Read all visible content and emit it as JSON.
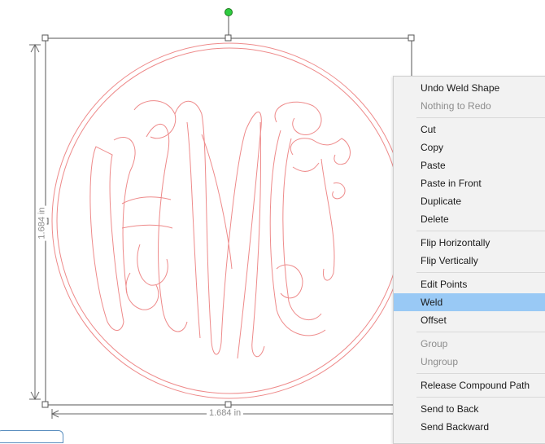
{
  "selection": {
    "width_label": "1.684 in",
    "height_label": "1.684 in"
  },
  "context_menu": {
    "groups": [
      [
        {
          "label": "Undo Weld Shape",
          "enabled": true
        },
        {
          "label": "Nothing to Redo",
          "enabled": false
        }
      ],
      [
        {
          "label": "Cut",
          "enabled": true
        },
        {
          "label": "Copy",
          "enabled": true
        },
        {
          "label": "Paste",
          "enabled": true
        },
        {
          "label": "Paste in Front",
          "enabled": true
        },
        {
          "label": "Duplicate",
          "enabled": true
        },
        {
          "label": "Delete",
          "enabled": true
        }
      ],
      [
        {
          "label": "Flip Horizontally",
          "enabled": true
        },
        {
          "label": "Flip Vertically",
          "enabled": true
        }
      ],
      [
        {
          "label": "Edit Points",
          "enabled": true
        },
        {
          "label": "Weld",
          "enabled": true,
          "highlighted": true
        },
        {
          "label": "Offset",
          "enabled": true
        }
      ],
      [
        {
          "label": "Group",
          "enabled": false
        },
        {
          "label": "Ungroup",
          "enabled": false
        }
      ],
      [
        {
          "label": "Release Compound Path",
          "enabled": true
        }
      ],
      [
        {
          "label": "Send to Back",
          "enabled": true
        },
        {
          "label": "Send Backward",
          "enabled": true
        }
      ]
    ]
  },
  "colors": {
    "shape_outline": "#ee8a8a",
    "handle_border": "#555555",
    "rotate_handle": "#2ecc40",
    "highlight": "#99c9f5"
  }
}
